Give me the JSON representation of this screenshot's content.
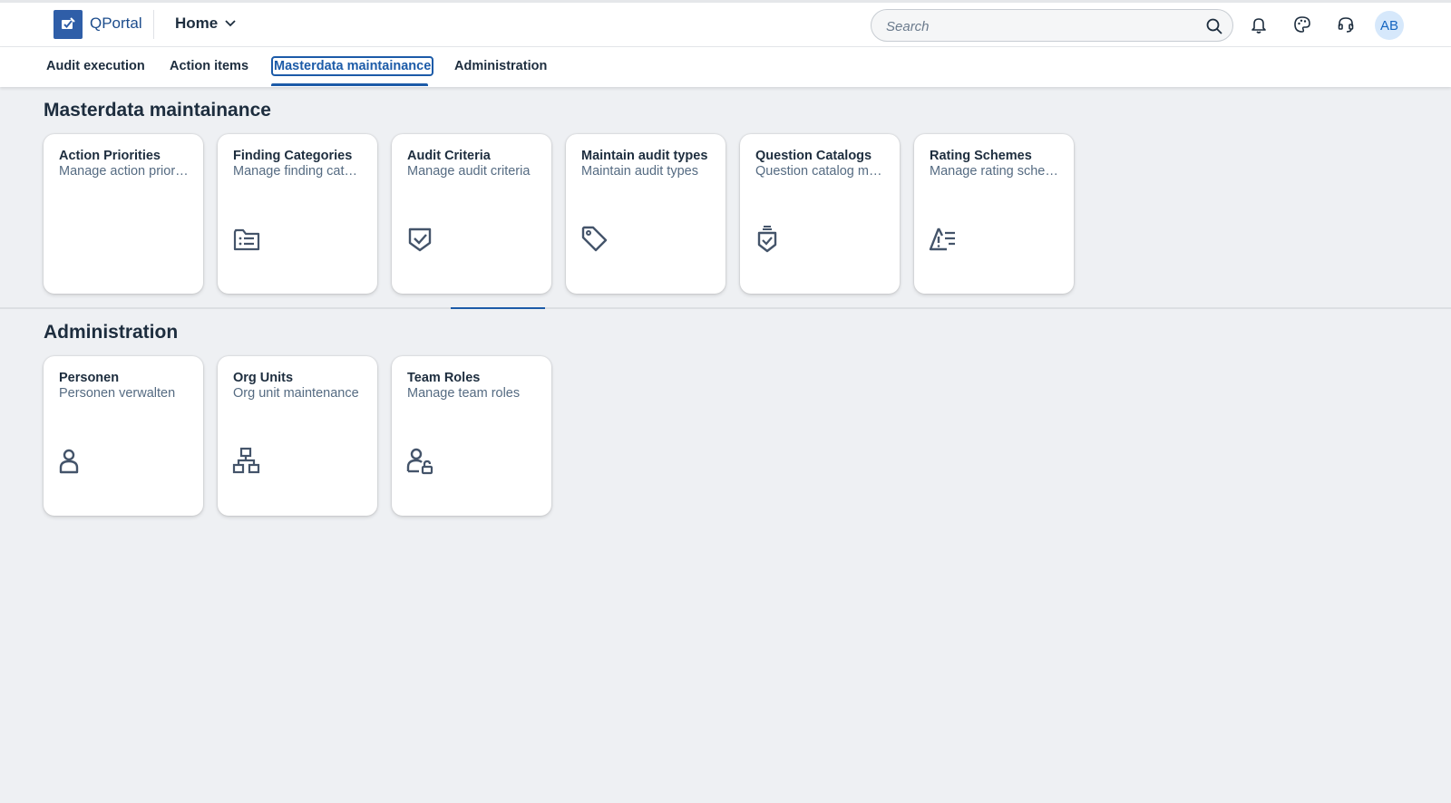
{
  "header": {
    "product_name": "QPortal",
    "home_label": "Home",
    "search_placeholder": "Search",
    "avatar_initials": "AB"
  },
  "tabs": [
    {
      "label": "Audit execution"
    },
    {
      "label": "Action items"
    },
    {
      "label": "Masterdata maintainance",
      "selected": true
    },
    {
      "label": "Administration"
    }
  ],
  "sections": {
    "masterdata": {
      "title": "Masterdata maintainance",
      "tiles": [
        {
          "title": "Action Priorities",
          "subtitle": "Manage action priorities",
          "icon": "none"
        },
        {
          "title": "Finding Categories",
          "subtitle": "Manage finding categories",
          "icon": "list-folder-icon"
        },
        {
          "title": "Audit Criteria",
          "subtitle": "Manage audit criteria",
          "icon": "shield-check-icon"
        },
        {
          "title": "Maintain audit types",
          "subtitle": "Maintain audit types",
          "icon": "tag-icon"
        },
        {
          "title": "Question Catalogs",
          "subtitle": "Question catalog maintenance",
          "icon": "catalog-check-icon"
        },
        {
          "title": "Rating Schemes",
          "subtitle": "Manage rating schemes",
          "icon": "warning-list-icon"
        }
      ]
    },
    "administration": {
      "title": "Administration",
      "tiles": [
        {
          "title": "Personen",
          "subtitle": "Personen verwalten",
          "icon": "person-icon"
        },
        {
          "title": "Org Units",
          "subtitle": "Org unit maintenance",
          "icon": "org-chart-icon"
        },
        {
          "title": "Team Roles",
          "subtitle": "Manage team roles",
          "icon": "person-lock-icon"
        }
      ]
    }
  },
  "colors": {
    "brand": "#2f5ea8",
    "selected_tab": "#1c5ba8",
    "background": "#eef0f3",
    "tile_bg": "#ffffff",
    "text": "#1d2d3e",
    "subtext": "#556b82"
  }
}
